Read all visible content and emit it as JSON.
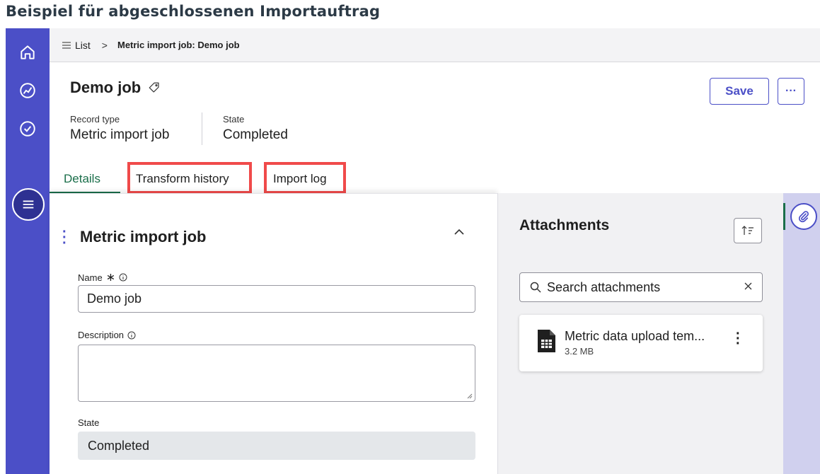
{
  "caption": "Beispiel für abgeschlossenen Importauftrag",
  "nav": {
    "items": [
      {
        "icon": "home-icon"
      },
      {
        "icon": "metrics-icon"
      },
      {
        "icon": "check-circle-icon"
      },
      {
        "icon": "list-icon",
        "active": true
      }
    ]
  },
  "breadcrumb": {
    "list_label": "List",
    "separator": ">",
    "current": "Metric import job: Demo job"
  },
  "record": {
    "title": "Demo job",
    "save_label": "Save",
    "more_label": "···",
    "record_type_label": "Record type",
    "record_type_value": "Metric import job",
    "state_label": "State",
    "state_value": "Completed"
  },
  "tabs": [
    {
      "label": "Details",
      "active": true
    },
    {
      "label": "Transform history",
      "highlighted": true
    },
    {
      "label": "Import log",
      "highlighted": true
    }
  ],
  "form": {
    "section_title": "Metric import job",
    "name_label": "Name",
    "name_required_mark": "∗",
    "name_value": "Demo job",
    "description_label": "Description",
    "description_value": "",
    "state_label": "State",
    "state_value": "Completed"
  },
  "attachments": {
    "title": "Attachments",
    "search_placeholder": "Search attachments",
    "files": [
      {
        "name": "Metric data upload tem...",
        "size": "3.2 MB",
        "icon": "spreadsheet-file-icon"
      }
    ]
  },
  "colors": {
    "nav_bg": "#4b4fc7",
    "accent": "#4b4fc7",
    "tab_active": "#1a6e4a",
    "highlight": "#f04a4a"
  }
}
